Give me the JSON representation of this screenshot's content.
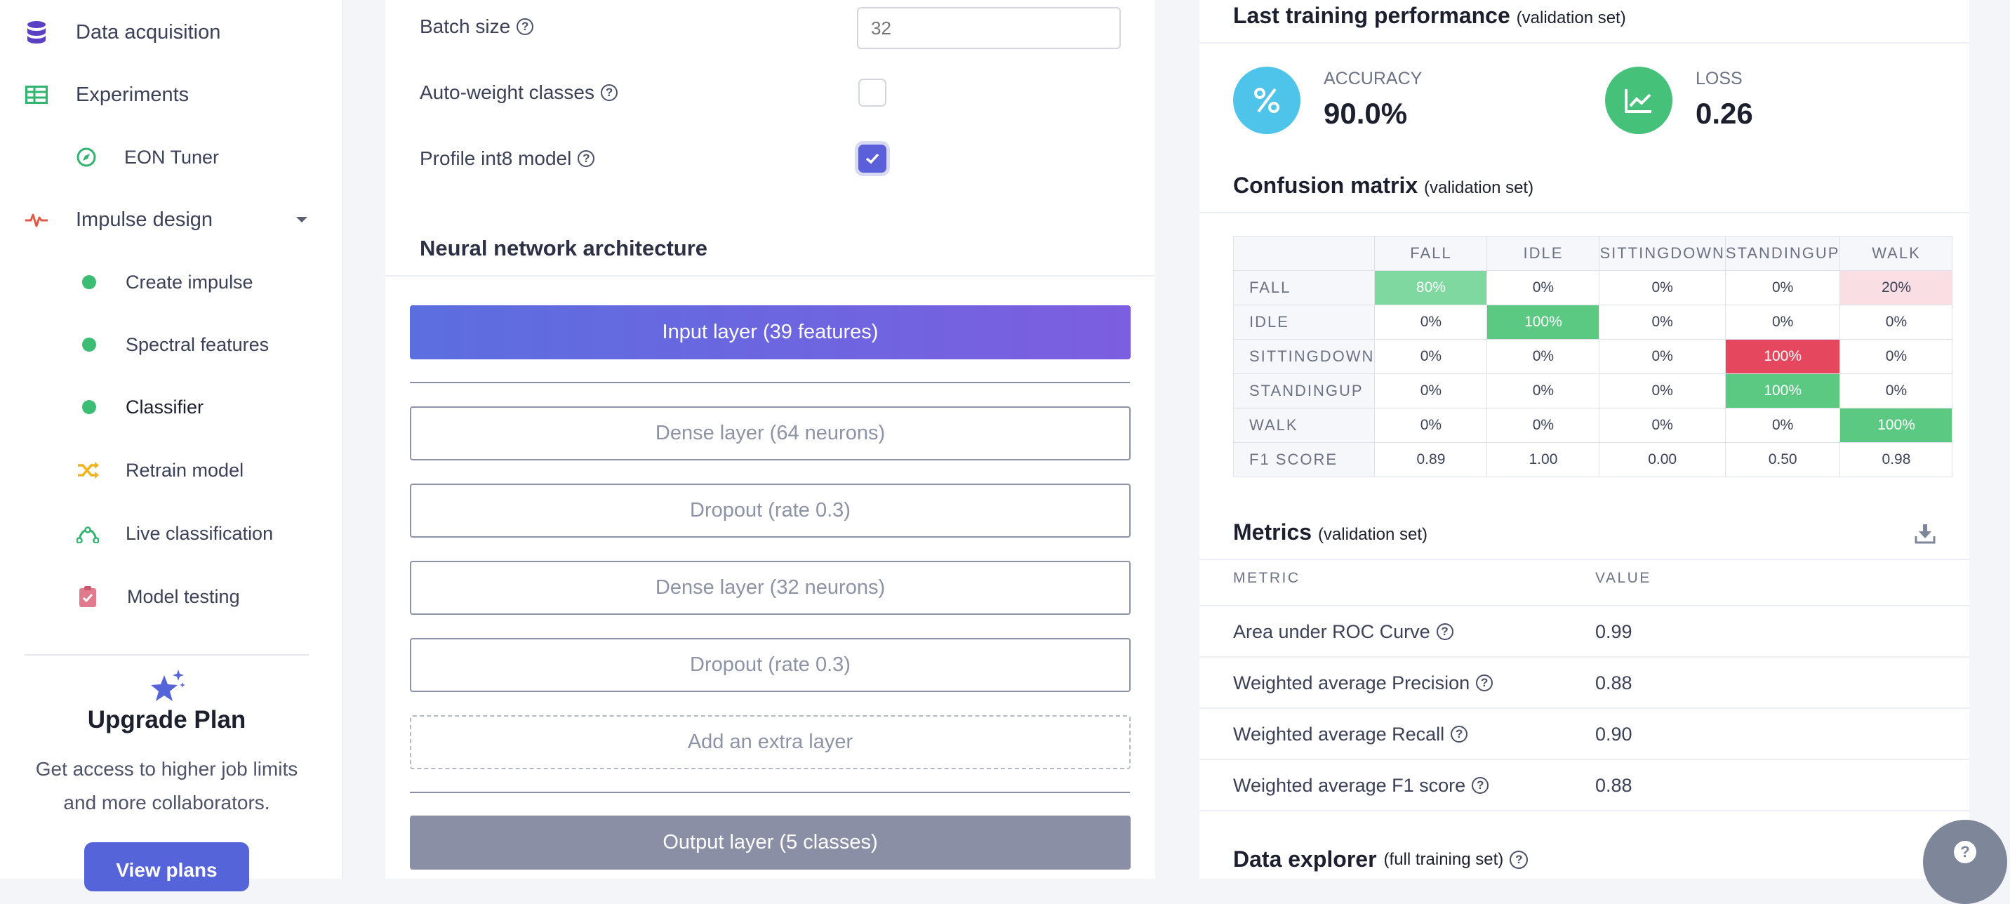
{
  "sidebar": {
    "items": [
      {
        "label": "Data acquisition",
        "icon": "database-icon",
        "color": "#5b3fc4"
      },
      {
        "label": "Experiments",
        "icon": "table-icon",
        "color": "#2fb56d"
      },
      {
        "label": "EON Tuner",
        "icon": "compass-icon",
        "color": "#2fb56d"
      },
      {
        "label": "Impulse design",
        "icon": "pulse-icon",
        "color": "#e05a4a"
      },
      {
        "label": "Create impulse",
        "icon": "dot-icon",
        "color": "#3cbd74"
      },
      {
        "label": "Spectral features",
        "icon": "dot-icon",
        "color": "#3cbd74"
      },
      {
        "label": "Classifier",
        "icon": "dot-icon",
        "color": "#3cbd74",
        "active": true
      },
      {
        "label": "Retrain model",
        "icon": "shuffle-icon",
        "color": "#f0b41c"
      },
      {
        "label": "Live classification",
        "icon": "curve-icon",
        "color": "#2fb56d"
      },
      {
        "label": "Model testing",
        "icon": "clipboard-check-icon",
        "color": "#e07a8c"
      }
    ],
    "upgrade": {
      "title": "Upgrade Plan",
      "description": "Get access to higher job limits and more collaborators.",
      "button": "View plans"
    }
  },
  "settings": {
    "batch_size_label": "Batch size",
    "batch_size_placeholder": "32",
    "auto_weight_label": "Auto-weight classes",
    "auto_weight_checked": false,
    "profile_int8_label": "Profile int8 model",
    "profile_int8_checked": true
  },
  "architecture": {
    "title": "Neural network architecture",
    "input_layer": "Input layer (39 features)",
    "layers": [
      "Dense layer (64 neurons)",
      "Dropout (rate 0.3)",
      "Dense layer (32 neurons)",
      "Dropout (rate 0.3)"
    ],
    "add_layer": "Add an extra layer",
    "output_layer": "Output layer (5 classes)"
  },
  "performance": {
    "title": "Last training performance",
    "subtitle": "(validation set)",
    "accuracy_label": "ACCURACY",
    "accuracy_value": "90.0%",
    "loss_label": "LOSS",
    "loss_value": "0.26"
  },
  "confusion": {
    "title": "Confusion matrix",
    "subtitle": "(validation set)",
    "columns": [
      "FALL",
      "IDLE",
      "SITTINGDOWN",
      "STANDINGUP",
      "WALK"
    ],
    "rows": [
      {
        "label": "FALL",
        "cells": [
          "80%",
          "0%",
          "0%",
          "0%",
          "20%"
        ],
        "colors": [
          "#7fd8a0",
          "",
          "",
          "",
          "#f9dfe3"
        ]
      },
      {
        "label": "IDLE",
        "cells": [
          "0%",
          "100%",
          "0%",
          "0%",
          "0%"
        ],
        "colors": [
          "",
          "#5bc981",
          "",
          "",
          ""
        ]
      },
      {
        "label": "SITTINGDOWN",
        "cells": [
          "0%",
          "0%",
          "0%",
          "100%",
          "0%"
        ],
        "colors": [
          "",
          "",
          "",
          "#e5485e",
          ""
        ]
      },
      {
        "label": "STANDINGUP",
        "cells": [
          "0%",
          "0%",
          "0%",
          "100%",
          "0%"
        ],
        "colors": [
          "",
          "",
          "",
          "#5bc981",
          ""
        ]
      },
      {
        "label": "WALK",
        "cells": [
          "0%",
          "0%",
          "0%",
          "0%",
          "100%"
        ],
        "colors": [
          "",
          "",
          "",
          "",
          "#5bc981"
        ]
      }
    ],
    "f1_label": "F1 SCORE",
    "f1_scores": [
      "0.89",
      "1.00",
      "0.00",
      "0.50",
      "0.98"
    ]
  },
  "metrics": {
    "title": "Metrics",
    "subtitle": "(validation set)",
    "col_metric": "METRIC",
    "col_value": "VALUE",
    "rows": [
      {
        "name": "Area under ROC Curve",
        "value": "0.99"
      },
      {
        "name": "Weighted average Precision",
        "value": "0.88"
      },
      {
        "name": "Weighted average Recall",
        "value": "0.90"
      },
      {
        "name": "Weighted average F1 score",
        "value": "0.88"
      }
    ]
  },
  "explorer": {
    "title": "Data explorer",
    "subtitle": "(full training set)"
  }
}
